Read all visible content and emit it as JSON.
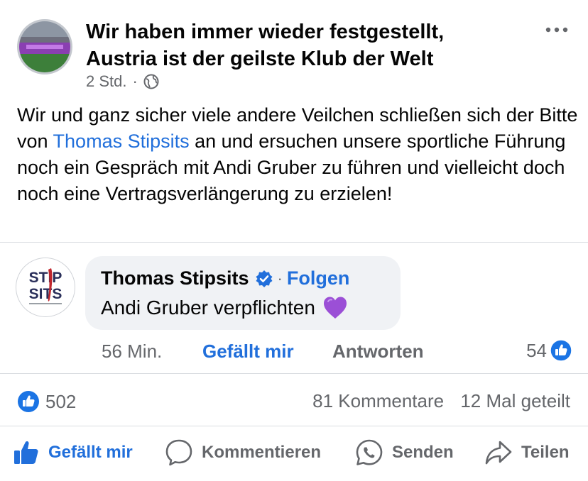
{
  "post": {
    "title_line1": "Wir haben immer wieder festgestellt,",
    "title_line2": "Austria ist der geilste Klub der Welt",
    "time": "2 Std.",
    "dot": "·",
    "privacy_icon": "globe-icon",
    "text_before": "Wir und ganz sicher viele andere Veilchen schließen sich der Bitte von ",
    "mention": "Thomas Stipsits",
    "text_after": " an und ersuchen unsere sportliche Führung noch ein Gespräch mit Andi Gruber zu führen und vielleicht doch noch eine Vertragsverlängerung zu erzielen!"
  },
  "comment": {
    "avatar_text_top": "STIP",
    "avatar_text_bottom": "SITS",
    "author": "Thomas Stipsits",
    "verified_icon": "verified-icon",
    "separator": "·",
    "follow": "Folgen",
    "text": "Andi Gruber verpflichten",
    "emoji": "purple-heart",
    "time": "56 Min.",
    "like": "Gefällt mir",
    "reply": "Antworten",
    "reaction_count": "54"
  },
  "stats": {
    "likes": "502",
    "comments": "81 Kommentare",
    "shares": "12 Mal geteilt"
  },
  "actions": {
    "like": "Gefällt mir",
    "comment": "Kommentieren",
    "send": "Senden",
    "share": "Teilen"
  },
  "colors": {
    "link_blue": "#216fdb",
    "meta_gray": "#65676b",
    "bubble_bg": "#f0f2f5",
    "heart_purple": "#9b4fd6"
  }
}
